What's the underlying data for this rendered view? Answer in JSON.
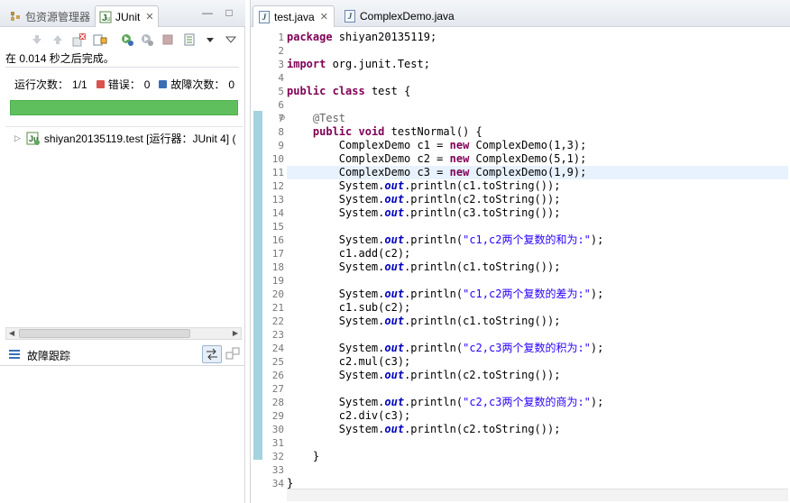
{
  "left_panel": {
    "tabs": [
      {
        "label": "包资源管理器",
        "active": false
      },
      {
        "label": "JUnit",
        "active": true
      }
    ],
    "close_glyph": "✕",
    "minimize_glyph": "—",
    "maximize_glyph": "□",
    "status": "在 0.014 秒之后完成。",
    "runs_label": "运行次数：",
    "runs_value": "1/1",
    "errors_label": "错误：",
    "errors_value": "0",
    "failures_label": "故障次数：",
    "failures_value": "0",
    "progress_fraction": 1.0,
    "progress_color": "#5fbf5c",
    "tree_item": "shiyan20135119.test [运行器：JUnit 4] (",
    "failure_trace_title": "故障跟踪"
  },
  "editor": {
    "tabs": [
      {
        "label": "test.java",
        "active": true
      },
      {
        "label": "ComplexDemo.java",
        "active": false
      }
    ],
    "highlighted_line": 11,
    "line_numbers": [
      "1",
      "2",
      "3",
      "4",
      "5",
      "6",
      "7",
      "8",
      "9",
      "10",
      "11",
      "12",
      "13",
      "14",
      "15",
      "16",
      "17",
      "18",
      "19",
      "20",
      "21",
      "22",
      "23",
      "24",
      "25",
      "26",
      "27",
      "28",
      "29",
      "30",
      "31",
      "32",
      "33",
      "34"
    ],
    "code": [
      [
        {
          "t": "package",
          "c": "kw"
        },
        {
          "t": " shiyan20135119;",
          "c": ""
        }
      ],
      [],
      [
        {
          "t": "import",
          "c": "kw"
        },
        {
          "t": " org.junit.Test;",
          "c": ""
        }
      ],
      [],
      [
        {
          "t": "public",
          "c": "kw"
        },
        {
          "t": " ",
          "c": ""
        },
        {
          "t": "class",
          "c": "kw"
        },
        {
          "t": " test {",
          "c": ""
        }
      ],
      [],
      [
        {
          "t": "    ",
          "c": ""
        },
        {
          "t": "@Test",
          "c": "ann"
        }
      ],
      [
        {
          "t": "    ",
          "c": ""
        },
        {
          "t": "public",
          "c": "kw"
        },
        {
          "t": " ",
          "c": ""
        },
        {
          "t": "void",
          "c": "kw"
        },
        {
          "t": " testNormal() {",
          "c": ""
        }
      ],
      [
        {
          "t": "        ComplexDemo c1 = ",
          "c": ""
        },
        {
          "t": "new",
          "c": "kw"
        },
        {
          "t": " ComplexDemo(1,3);",
          "c": ""
        }
      ],
      [
        {
          "t": "        ComplexDemo c2 = ",
          "c": ""
        },
        {
          "t": "new",
          "c": "kw"
        },
        {
          "t": " ComplexDemo(5,1);",
          "c": ""
        }
      ],
      [
        {
          "t": "        ComplexDemo c3 = ",
          "c": ""
        },
        {
          "t": "new",
          "c": "kw"
        },
        {
          "t": " ComplexDemo(1,9);",
          "c": ""
        }
      ],
      [
        {
          "t": "        System.",
          "c": ""
        },
        {
          "t": "out",
          "c": "fld"
        },
        {
          "t": ".println(c1.toString());",
          "c": ""
        }
      ],
      [
        {
          "t": "        System.",
          "c": ""
        },
        {
          "t": "out",
          "c": "fld"
        },
        {
          "t": ".println(c2.toString());",
          "c": ""
        }
      ],
      [
        {
          "t": "        System.",
          "c": ""
        },
        {
          "t": "out",
          "c": "fld"
        },
        {
          "t": ".println(c3.toString());",
          "c": ""
        }
      ],
      [],
      [
        {
          "t": "        System.",
          "c": ""
        },
        {
          "t": "out",
          "c": "fld"
        },
        {
          "t": ".println(",
          "c": ""
        },
        {
          "t": "\"c1,c2两个复数的和为:\"",
          "c": "str"
        },
        {
          "t": ");",
          "c": ""
        }
      ],
      [
        {
          "t": "        c1.add(c2);",
          "c": ""
        }
      ],
      [
        {
          "t": "        System.",
          "c": ""
        },
        {
          "t": "out",
          "c": "fld"
        },
        {
          "t": ".println(c1.toString());",
          "c": ""
        }
      ],
      [],
      [
        {
          "t": "        System.",
          "c": ""
        },
        {
          "t": "out",
          "c": "fld"
        },
        {
          "t": ".println(",
          "c": ""
        },
        {
          "t": "\"c1,c2两个复数的差为:\"",
          "c": "str"
        },
        {
          "t": ");",
          "c": ""
        }
      ],
      [
        {
          "t": "        c1.sub(c2);",
          "c": ""
        }
      ],
      [
        {
          "t": "        System.",
          "c": ""
        },
        {
          "t": "out",
          "c": "fld"
        },
        {
          "t": ".println(c1.toString());",
          "c": ""
        }
      ],
      [],
      [
        {
          "t": "        System.",
          "c": ""
        },
        {
          "t": "out",
          "c": "fld"
        },
        {
          "t": ".println(",
          "c": ""
        },
        {
          "t": "\"c2,c3两个复数的积为:\"",
          "c": "str"
        },
        {
          "t": ");",
          "c": ""
        }
      ],
      [
        {
          "t": "        c2.mul(c3);",
          "c": ""
        }
      ],
      [
        {
          "t": "        System.",
          "c": ""
        },
        {
          "t": "out",
          "c": "fld"
        },
        {
          "t": ".println(c2.toString());",
          "c": ""
        }
      ],
      [],
      [
        {
          "t": "        System.",
          "c": ""
        },
        {
          "t": "out",
          "c": "fld"
        },
        {
          "t": ".println(",
          "c": ""
        },
        {
          "t": "\"c2,c3两个复数的商为:\"",
          "c": "str"
        },
        {
          "t": ");",
          "c": ""
        }
      ],
      [
        {
          "t": "        c2.div(c3);",
          "c": ""
        }
      ],
      [
        {
          "t": "        System.",
          "c": ""
        },
        {
          "t": "out",
          "c": "fld"
        },
        {
          "t": ".println(c2.toString());",
          "c": ""
        }
      ],
      [],
      [
        {
          "t": "    }",
          "c": ""
        }
      ],
      [],
      [
        {
          "t": "}",
          "c": ""
        }
      ]
    ]
  },
  "colors": {
    "keyword": "#7f0055",
    "string": "#2a00ff",
    "field": "#0000c0",
    "annotation": "#646464",
    "line_highlight": "#e8f2fe",
    "error_x": "#d9534f",
    "failure_x": "#3a6fb5"
  },
  "icons": [
    "package-explorer-icon",
    "junit-icon",
    "next-failure-icon",
    "previous-failure-icon",
    "show-failures-only-icon",
    "scroll-lock-icon",
    "rerun-icon",
    "rerun-failed-icon",
    "stop-icon",
    "history-icon",
    "view-menu-icon",
    "test-class-icon",
    "list-icon",
    "compare-icon",
    "filter-trace-icon",
    "java-file-icon",
    "fold-collapse-icon"
  ]
}
